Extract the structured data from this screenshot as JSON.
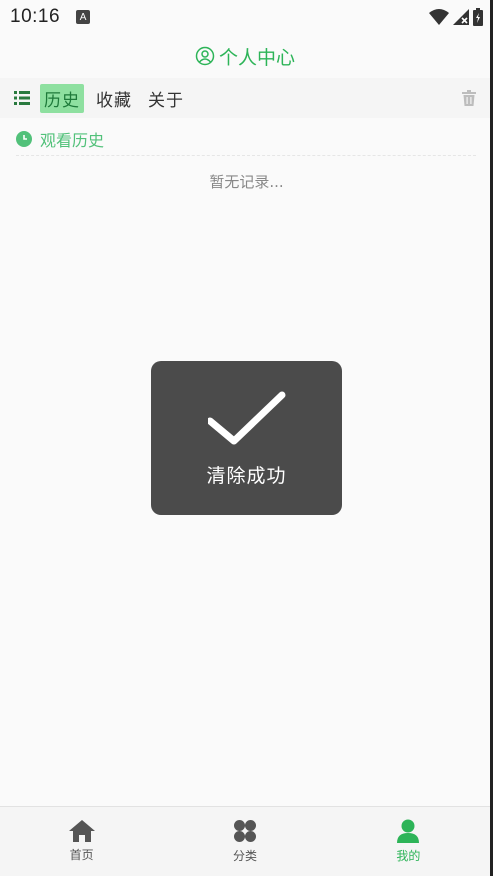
{
  "status": {
    "time": "10:16",
    "a_label": "A"
  },
  "header": {
    "title": "个人中心"
  },
  "tabs": [
    {
      "label": "历史",
      "active": true
    },
    {
      "label": "收藏",
      "active": false
    },
    {
      "label": "关于",
      "active": false
    }
  ],
  "section": {
    "label": "观看历史"
  },
  "empty_text": "暂无记录...",
  "toast": {
    "text": "清除成功"
  },
  "nav": [
    {
      "label": "首页",
      "icon": "home-icon",
      "active": false
    },
    {
      "label": "分类",
      "icon": "category-icon",
      "active": false
    },
    {
      "label": "我的",
      "icon": "user-icon",
      "active": true
    }
  ],
  "colors": {
    "accent": "#2db458",
    "tab_active_bg": "#8ee0a0",
    "toast_bg": "#4b4b4b"
  }
}
